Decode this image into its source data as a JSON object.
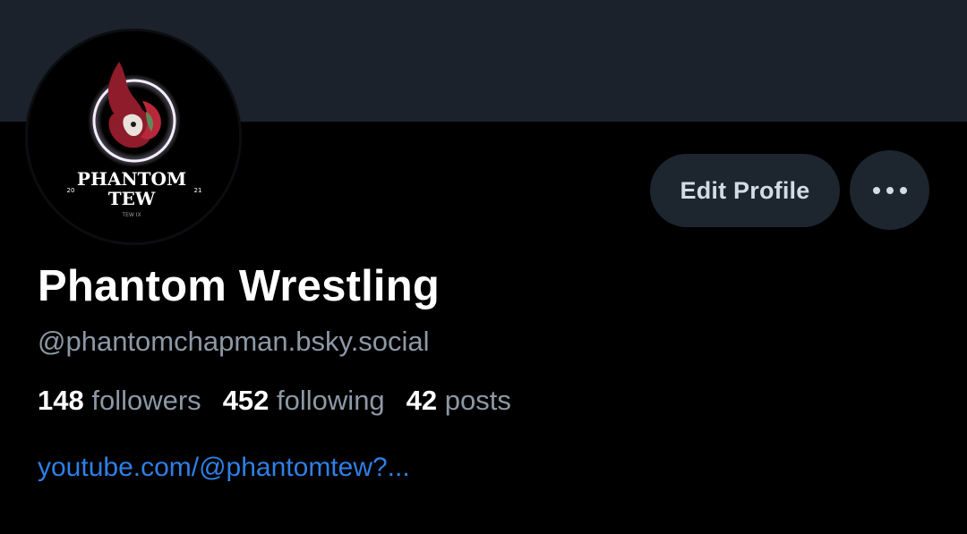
{
  "profile": {
    "display_name": "Phantom Wrestling",
    "handle": "@phantomchapman.bsky.social",
    "link": "youtube.com/@phantomtew?...",
    "avatar_text": {
      "line1": "PHANTOM",
      "line2": "TEW",
      "year_left": "20",
      "year_right": "21",
      "sub": "TEW IX"
    }
  },
  "stats": {
    "followers": {
      "count": "148",
      "label": "followers"
    },
    "following": {
      "count": "452",
      "label": "following"
    },
    "posts": {
      "count": "42",
      "label": "posts"
    }
  },
  "actions": {
    "edit_label": "Edit Profile",
    "more_icon": "ellipsis-horizontal-icon"
  },
  "colors": {
    "background": "#000000",
    "banner": "#1b222c",
    "button_bg": "#1d252e",
    "secondary_text": "#8d98a5",
    "link": "#2f7fe6"
  }
}
